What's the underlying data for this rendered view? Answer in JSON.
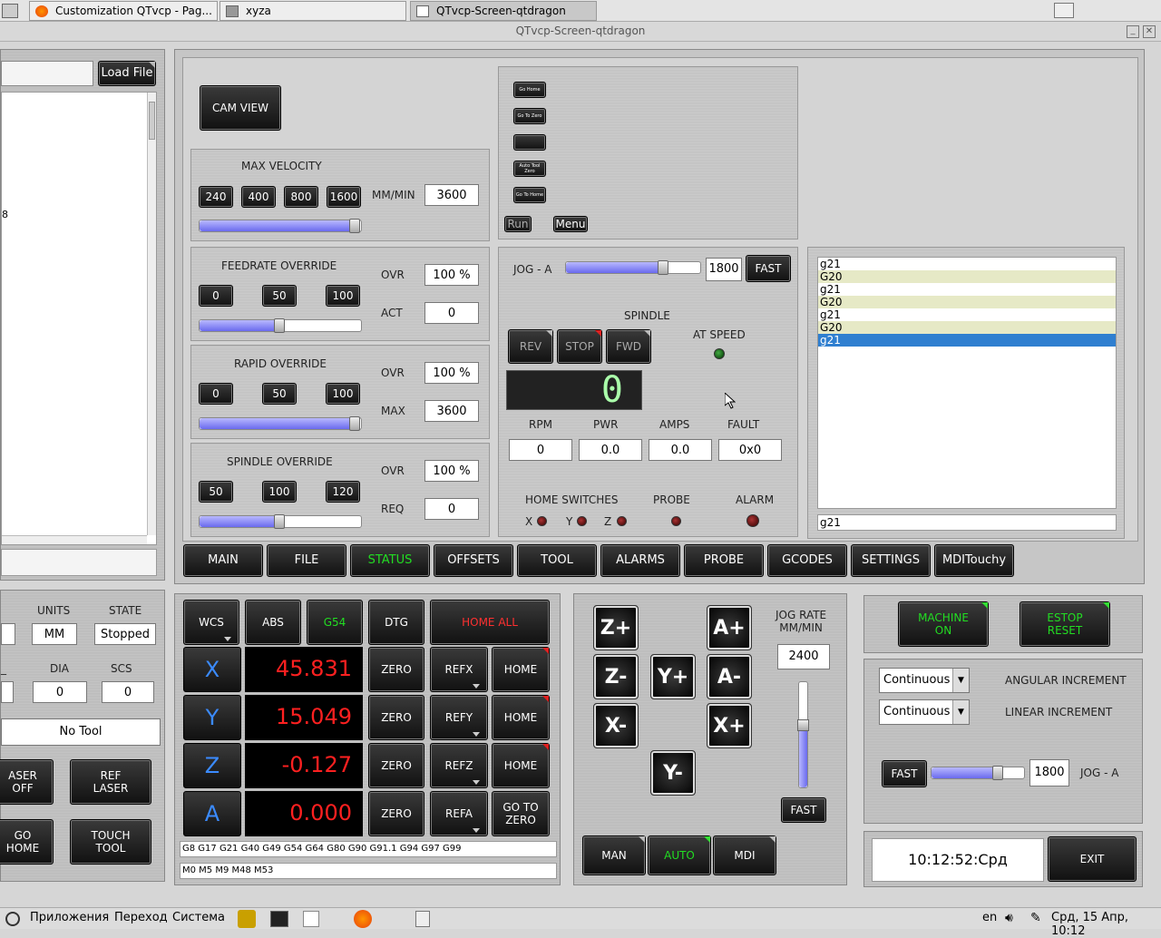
{
  "tabs": [
    {
      "label": "Customization QTvcp - Pag..."
    },
    {
      "label": "xyza"
    },
    {
      "label": "QTvcp-Screen-qtdragon"
    }
  ],
  "window_title": "QTvcp-Screen-qtdragon",
  "file_panel": {
    "load_label": "Load File",
    "fragment": "8"
  },
  "cam_view": "CAM VIEW",
  "max_velocity": {
    "title": "MAX VELOCITY",
    "buttons": [
      "240",
      "400",
      "800",
      "1600"
    ],
    "unit": "MM/MIN",
    "value": "3600",
    "slider_fraction": 1.0
  },
  "feedrate": {
    "title": "FEEDRATE OVERRIDE",
    "buttons": [
      "0",
      "50",
      "100"
    ],
    "ovr_label": "OVR",
    "ovr": "100 %",
    "act_label": "ACT",
    "act": "0",
    "slider_fraction": 0.5
  },
  "rapid": {
    "title": "RAPID OVERRIDE",
    "buttons": [
      "0",
      "50",
      "100"
    ],
    "ovr_label": "OVR",
    "ovr": "100 %",
    "max_label": "MAX",
    "max": "3600",
    "slider_fraction": 1.0
  },
  "spindle_ovr": {
    "title": "SPINDLE OVERRIDE",
    "buttons": [
      "50",
      "100",
      "120"
    ],
    "ovr_label": "OVR",
    "ovr": "100 %",
    "req_label": "REQ",
    "req": "0",
    "slider_fraction": 0.5
  },
  "macros": {
    "small_buttons": [
      "Go Home",
      "Go To Zero",
      "",
      "Auto Tool Zero",
      "Go To Home"
    ],
    "run": "Run",
    "menu": "Menu"
  },
  "jog_a": {
    "label": "JOG - A",
    "value": "1800",
    "fast": "FAST",
    "slider_fraction": 0.75
  },
  "spindle": {
    "title": "SPINDLE",
    "rev": "REV",
    "stop": "STOP",
    "fwd": "FWD",
    "at_speed": "AT SPEED",
    "display": "0",
    "labels": [
      "RPM",
      "PWR",
      "AMPS",
      "FAULT"
    ],
    "values": [
      "0",
      "0.0",
      "0.0",
      "0x0"
    ]
  },
  "switches": {
    "home_label": "HOME SWITCHES",
    "probe": "PROBE",
    "alarm": "ALARM",
    "axes": [
      "X",
      "Y",
      "Z"
    ]
  },
  "gcode_list": {
    "items": [
      "g21",
      "G20",
      "g21",
      "G20",
      "g21",
      "G20",
      "g21"
    ],
    "selected": 6,
    "mdi_value": "g21"
  },
  "main_tabs": [
    "MAIN",
    "FILE",
    "STATUS",
    "OFFSETS",
    "TOOL",
    "ALARMS",
    "PROBE",
    "GCODES",
    "SETTINGS",
    "MDITouchy"
  ],
  "active_tab": "STATUS",
  "status_left": {
    "units_label": "UNITS",
    "state_label": "STATE",
    "units": "MM",
    "state": "Stopped",
    "dia_label": "DIA",
    "scs_label": "SCS",
    "dia": "0",
    "scs": "0",
    "tool": "No Tool",
    "laser_off": "ASER\nOFF",
    "ref_laser": "REF\nLASER",
    "go_home": "GO\nHOME",
    "touch_tool": "TOUCH\nTOOL"
  },
  "dro": {
    "wcs": "WCS",
    "abs": "ABS",
    "g54": "G54",
    "dtg": "DTG",
    "home_all": "HOME ALL",
    "axes": [
      {
        "name": "X",
        "value": "45.831",
        "ref": "REFX",
        "last": "HOME"
      },
      {
        "name": "Y",
        "value": "15.049",
        "ref": "REFY",
        "last": "HOME"
      },
      {
        "name": "Z",
        "value": "-0.127",
        "ref": "REFZ",
        "last": "HOME"
      },
      {
        "name": "A",
        "value": "0.000",
        "ref": "REFA",
        "last": "GO TO\nZERO"
      }
    ],
    "zero": "ZERO",
    "gcodes_active": "G8 G17 G21 G40 G49 G54 G64 G80 G90 G91.1 G94 G97 G99",
    "mcodes_active": "M0 M5 M9 M48 M53"
  },
  "jog_panel": {
    "buttons": [
      "Z+",
      "Z-",
      "X-",
      "A+",
      "A-",
      "X+",
      "Y+",
      "Y-"
    ],
    "rate_label": "JOG RATE\nMM/MIN",
    "rate": "2400",
    "fast": "FAST",
    "slider_fraction": 0.6,
    "modes": [
      "MAN",
      "AUTO",
      "MDI"
    ]
  },
  "right_panel": {
    "machine_on": "MACHINE\nON",
    "estop": "ESTOP\nRESET",
    "angular": "Continuous",
    "angular_label": "ANGULAR INCREMENT",
    "linear": "Continuous",
    "linear_label": "LINEAR INCREMENT",
    "fast": "FAST",
    "jog_value": "1800",
    "jog_label": "JOG - A",
    "slider_fraction": 0.75,
    "clock": "10:12:52:Срд",
    "exit": "EXIT"
  },
  "taskbar": {
    "apps": "Приложения",
    "go": "Переход",
    "system": "Система",
    "lang": "en",
    "datetime": "Срд, 15 Апр, 10:12"
  }
}
